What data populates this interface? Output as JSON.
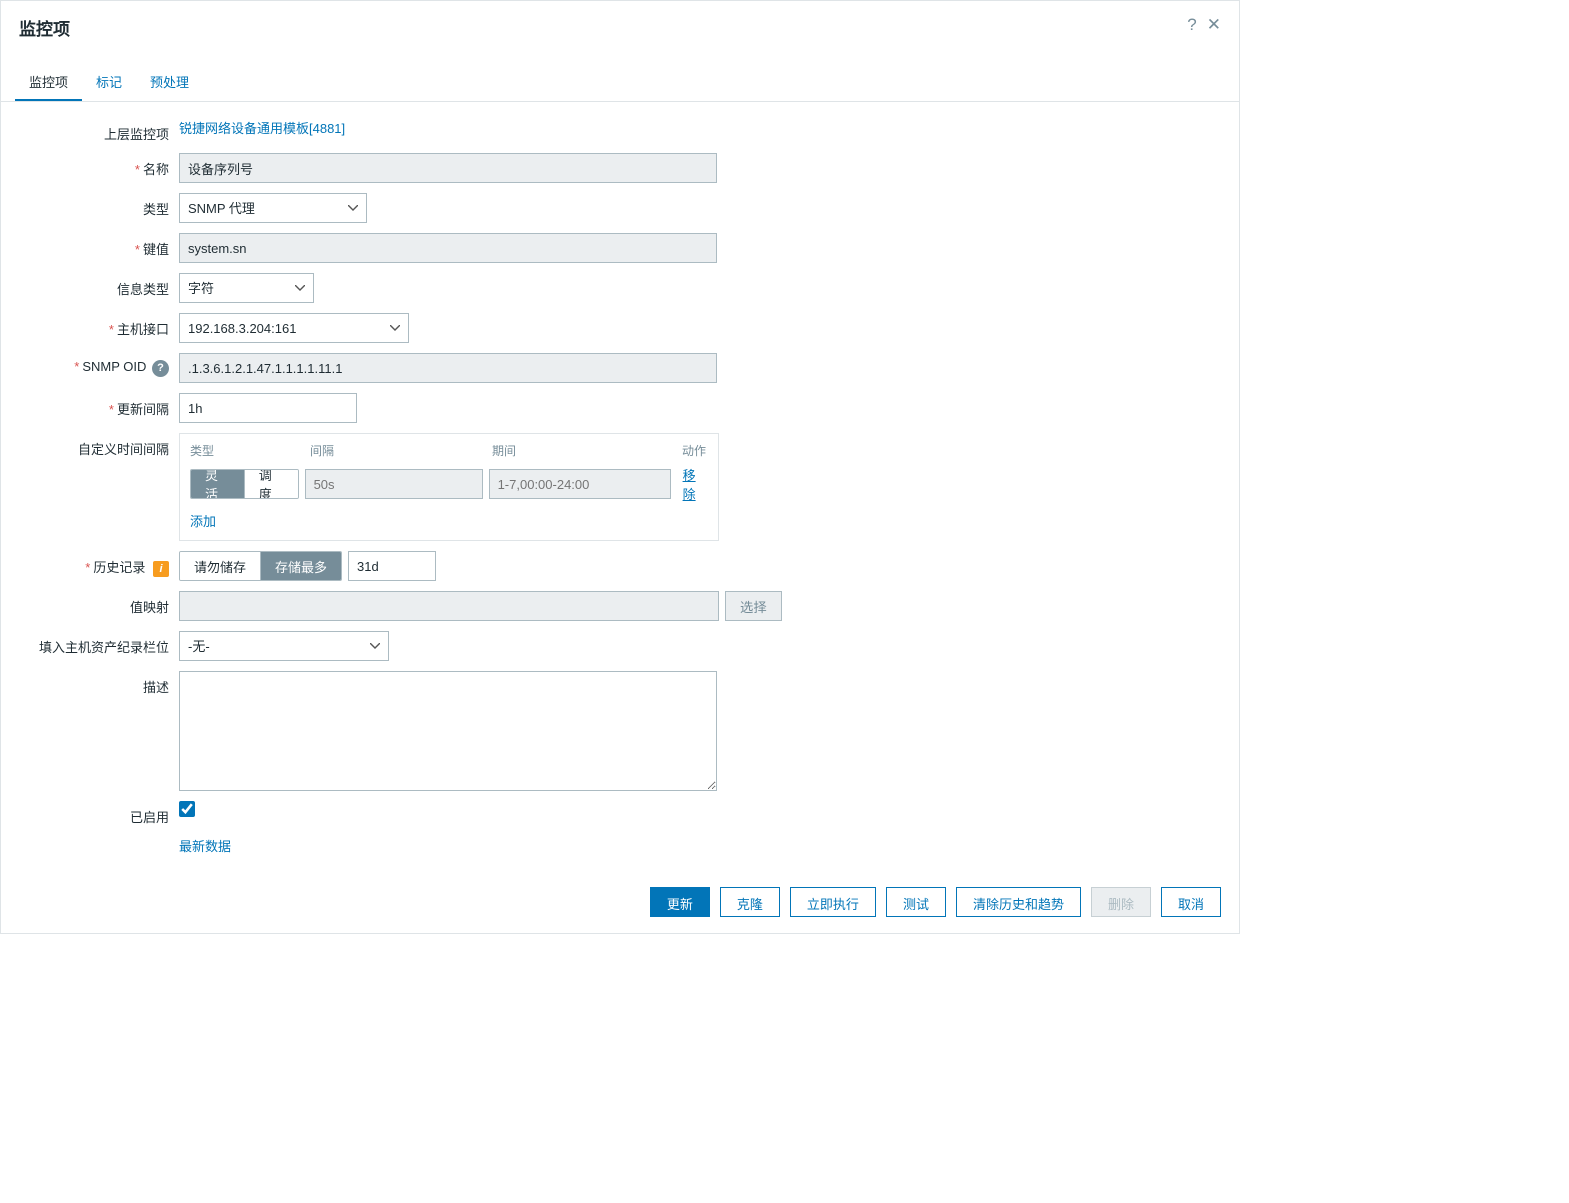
{
  "header": {
    "title": "监控项"
  },
  "tabs": [
    {
      "label": "监控项",
      "active": true
    },
    {
      "label": "标记",
      "active": false
    },
    {
      "label": "预处理",
      "active": false
    }
  ],
  "form": {
    "parent": {
      "label": "上层监控项",
      "link_text": "锐捷网络设备通用模板[4881]"
    },
    "name": {
      "label": "名称",
      "required": true,
      "value": "设备序列号"
    },
    "type": {
      "label": "类型",
      "value": "SNMP 代理"
    },
    "key": {
      "label": "键值",
      "required": true,
      "value": "system.sn"
    },
    "info_type": {
      "label": "信息类型",
      "value": "字符"
    },
    "host_iface": {
      "label": "主机接口",
      "required": true,
      "value": "192.168.3.204:161"
    },
    "snmp_oid": {
      "label": "SNMP OID",
      "required": true,
      "value": ".1.3.6.1.2.1.47.1.1.1.1.11.1"
    },
    "update_interval": {
      "label": "更新间隔",
      "required": true,
      "value": "1h"
    },
    "custom_intervals": {
      "label": "自定义时间间隔",
      "col_type": "类型",
      "col_interval": "间隔",
      "col_period": "期间",
      "col_action": "动作",
      "seg_flex": "灵活",
      "seg_sched": "调度",
      "interval_placeholder": "50s",
      "period_placeholder": "1-7,00:00-24:00",
      "remove": "移除",
      "add": "添加"
    },
    "history": {
      "label": "历史记录",
      "required": true,
      "opt_none": "请勿储存",
      "opt_store": "存储最多",
      "value": "31d"
    },
    "value_map": {
      "label": "值映射",
      "value": "",
      "select_btn": "选择"
    },
    "asset": {
      "label": "填入主机资产纪录栏位",
      "value": "-无-"
    },
    "description": {
      "label": "描述",
      "value": ""
    },
    "enabled": {
      "label": "已启用",
      "checked": true
    },
    "latest_data": "最新数据"
  },
  "footer": {
    "update": "更新",
    "clone": "克隆",
    "execute": "立即执行",
    "test": "测试",
    "clear": "清除历史和趋势",
    "delete": "删除",
    "cancel": "取消"
  }
}
